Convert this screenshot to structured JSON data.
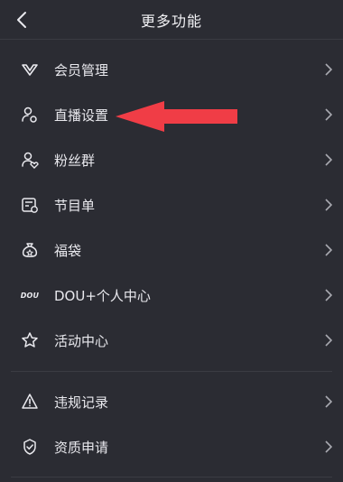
{
  "header": {
    "title": "更多功能"
  },
  "menu": [
    {
      "label": "会员管理",
      "icon": "vip-icon"
    },
    {
      "label": "直播设置",
      "icon": "live-settings-icon"
    },
    {
      "label": "粉丝群",
      "icon": "fan-group-icon"
    },
    {
      "label": "节目单",
      "icon": "program-list-icon"
    },
    {
      "label": "福袋",
      "icon": "lucky-bag-icon"
    },
    {
      "label": "DOU+个人中心",
      "icon": "dou-plus-icon",
      "icon_text": "DOU"
    },
    {
      "label": "活动中心",
      "icon": "star-icon"
    }
  ],
  "menu2": [
    {
      "label": "违规记录",
      "icon": "warning-icon"
    },
    {
      "label": "资质申请",
      "icon": "shield-check-icon"
    }
  ],
  "colors": {
    "background": "#2b2c33",
    "text": "#e9e9ee",
    "arrow": "#f03d46"
  }
}
